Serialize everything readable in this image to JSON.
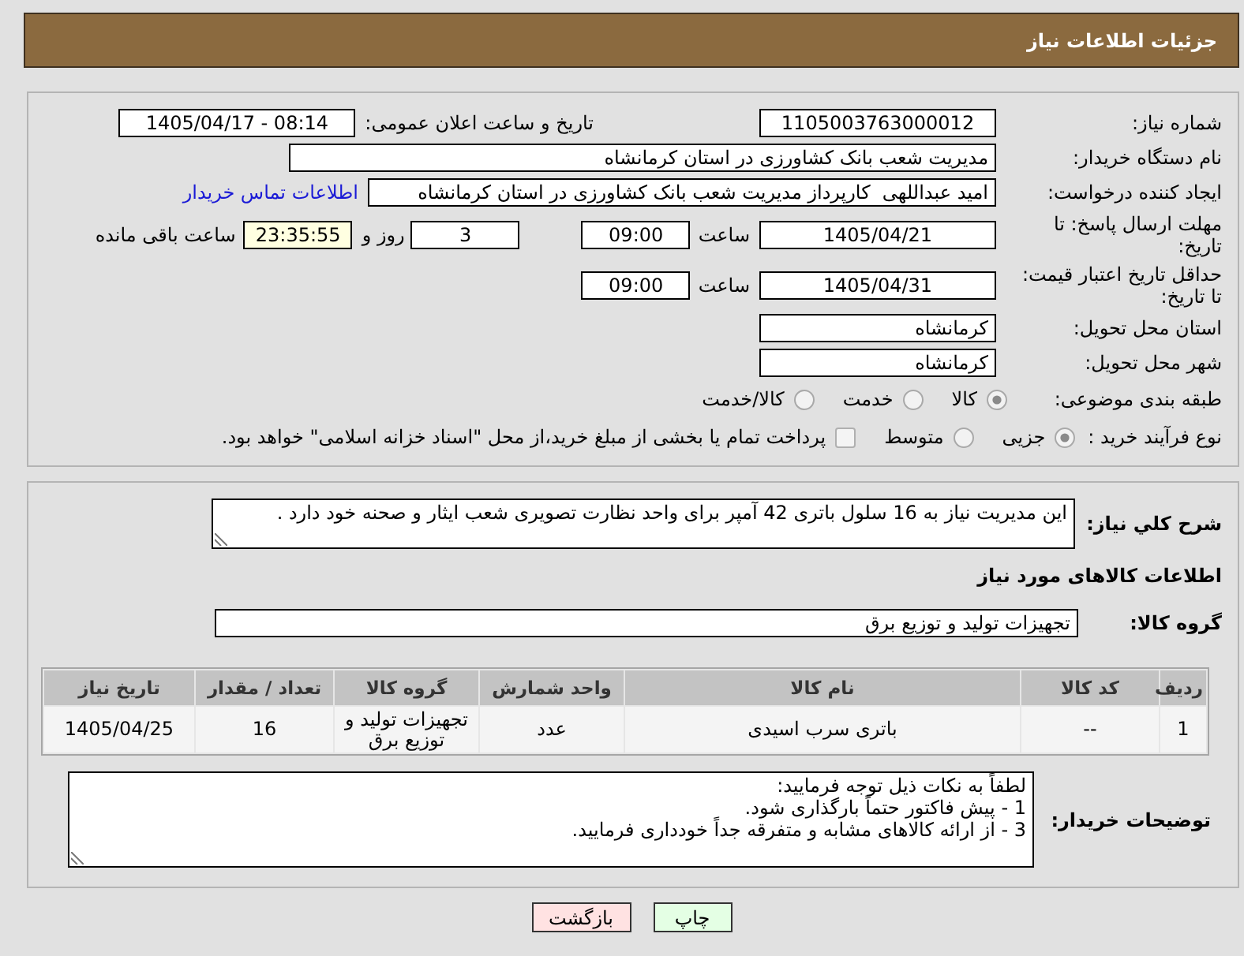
{
  "header": {
    "title": "جزئیات اطلاعات نیاز"
  },
  "details": {
    "need_number": {
      "label": "شماره نیاز:",
      "value": "1105003763000012"
    },
    "announcement": {
      "label": "تاریخ و ساعت اعلان عمومی:",
      "value": "1405/04/17 - 08:14"
    },
    "buyer_org": {
      "label": "نام دستگاه خریدار:",
      "value": "مدیریت شعب بانک کشاورزی در استان کرمانشاه"
    },
    "requester": {
      "label": "ایجاد کننده درخواست:",
      "value": "امید عبداللهی  کارپرداز مدیریت شعب بانک کشاورزی در استان کرمانشاه",
      "link": "اطلاعات تماس خریدار"
    },
    "response_deadline": {
      "label": "مهلت ارسال پاسخ: تا تاریخ:",
      "date": "1405/04/21",
      "time_label": "ساعت",
      "time": "09:00",
      "days": "3",
      "days_label": "روز و",
      "remaining": "23:35:55",
      "remaining_label": "ساعت باقی مانده"
    },
    "price_validity": {
      "label": "حداقل تاریخ اعتبار قیمت: تا تاریخ:",
      "date": "1405/04/31",
      "time_label": "ساعت",
      "time": "09:00"
    },
    "delivery_province": {
      "label": "استان محل تحویل:",
      "value": "کرمانشاه"
    },
    "delivery_city": {
      "label": "شهر محل تحویل:",
      "value": "کرمانشاه"
    },
    "category": {
      "label": "طبقه بندی موضوعی:",
      "options": [
        {
          "label": "کالا",
          "selected": true
        },
        {
          "label": "خدمت",
          "selected": false
        },
        {
          "label": "کالا/خدمت",
          "selected": false
        }
      ]
    },
    "purchase_type": {
      "label": "نوع فرآیند خرید :",
      "options": [
        {
          "label": "جزیی",
          "selected": true
        },
        {
          "label": "متوسط",
          "selected": false
        }
      ],
      "treasury_payment": {
        "label": "پرداخت تمام یا بخشی از مبلغ خرید،از محل \"اسناد خزانه اسلامی\" خواهد بود.",
        "checked": false
      }
    }
  },
  "description": {
    "label": "شرح کلي نیاز:",
    "value": "این مدیریت نیاز به 16 سلول باتری 42 آمپر برای واحد نظارت تصویری شعب ایثار و صحنه خود دارد ."
  },
  "goods": {
    "title": "اطلاعات کالاهای مورد نیاز",
    "group": {
      "label": "گروه کالا:",
      "value": "تجهیزات تولید و توزیع برق"
    },
    "table": {
      "columns": [
        "ردیف",
        "کد کالا",
        "نام کالا",
        "واحد شمارش",
        "گروه کالا",
        "تعداد / مقدار",
        "تاریخ نیاز"
      ],
      "rows": [
        [
          "1",
          "--",
          "باتری سرب اسیدی",
          "عدد",
          "تجهیزات تولید و توزیع برق",
          "16",
          "1405/04/25"
        ]
      ]
    }
  },
  "buyer_notes": {
    "label": "توضیحات خریدار:",
    "value": "لطفاً به نکات ذیل توجه فرمایید:\n1 - پیش فاکتور حتماً بارگذاری شود.\n3 - از ارائه کالاهای مشابه و متفرقه جداً خودداری فرمایید."
  },
  "buttons": [
    {
      "kind": "print",
      "label": "چاپ"
    },
    {
      "kind": "back",
      "label": "بازگشت"
    }
  ]
}
